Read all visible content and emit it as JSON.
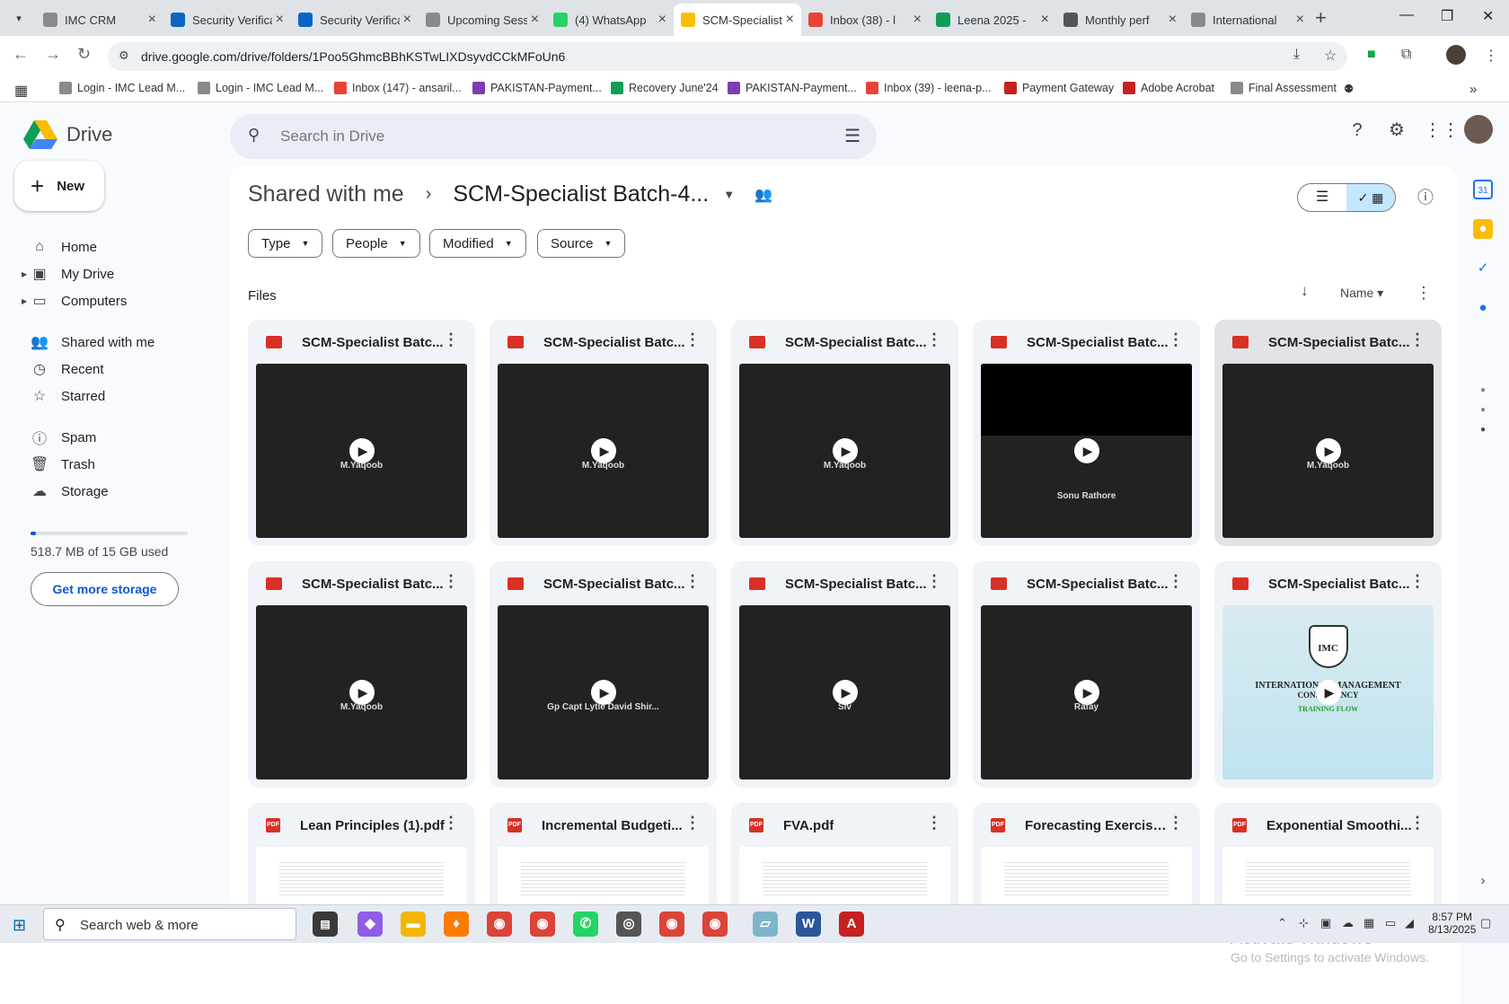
{
  "tabs": [
    {
      "label": "IMC CRM",
      "icon": "imc-icon",
      "color": "#8a8a8a"
    },
    {
      "label": "Security Verification",
      "icon": "linkedin-icon",
      "color": "#0a66c2"
    },
    {
      "label": "Security Verification",
      "icon": "linkedin-icon",
      "color": "#0a66c2"
    },
    {
      "label": "Upcoming Sessions",
      "icon": "imc-icon",
      "color": "#8a8a8a"
    },
    {
      "label": "(4) WhatsApp",
      "icon": "whatsapp-icon",
      "color": "#25d366"
    },
    {
      "label": "SCM-Specialist",
      "icon": "drive-icon",
      "color": "#fbbc04"
    },
    {
      "label": "Inbox (38) - l",
      "icon": "gmail-icon",
      "color": "#ea4335"
    },
    {
      "label": "Leena 2025 -",
      "icon": "sheets-icon",
      "color": "#0f9d58"
    },
    {
      "label": "Monthly perf",
      "icon": "openai-icon",
      "color": "#555555"
    },
    {
      "label": "International",
      "icon": "imc-icon",
      "color": "#8a8a8a"
    }
  ],
  "browser": {
    "url": "drive.google.com/drive/folders/1Poo5GhmcBBhKSTwLIXDsyvdCCkMFoUn6"
  },
  "bookmarks": [
    {
      "label": "Login - IMC Lead M...",
      "color": "#8a8a8a"
    },
    {
      "label": "Login - IMC Lead M...",
      "color": "#8a8a8a"
    },
    {
      "label": "Inbox (147) - ansaril...",
      "color": "#ea4335"
    },
    {
      "label": "PAKISTAN-Payment...",
      "color": "#7b3fb0"
    },
    {
      "label": "Recovery June'24",
      "color": "#0f9d58"
    },
    {
      "label": "PAKISTAN-Payment...",
      "color": "#7b3fb0"
    },
    {
      "label": "Inbox (39) - leena-p...",
      "color": "#ea4335"
    },
    {
      "label": "Payment Gateway",
      "color": "#c5221f"
    },
    {
      "label": "Adobe Acrobat",
      "color": "#c5221f"
    },
    {
      "label": "Final Assessment",
      "color": "#8a8a8a"
    }
  ],
  "drive": {
    "brand": "Drive",
    "search_placeholder": "Search in Drive",
    "new_label": "New",
    "nav": [
      {
        "label": "Home",
        "icon": "home-icon"
      },
      {
        "label": "My Drive",
        "icon": "my-drive-icon"
      },
      {
        "label": "Computers",
        "icon": "computers-icon"
      },
      {
        "label": "Shared with me",
        "icon": "shared-icon"
      },
      {
        "label": "Recent",
        "icon": "recent-icon"
      },
      {
        "label": "Starred",
        "icon": "star-icon"
      },
      {
        "label": "Spam",
        "icon": "spam-icon"
      },
      {
        "label": "Trash",
        "icon": "trash-icon"
      },
      {
        "label": "Storage",
        "icon": "cloud-icon"
      }
    ],
    "storage_text": "518.7 MB of 15 GB used",
    "storage_fraction": 0.035,
    "get_more": "Get more storage",
    "breadcrumb_parent": "Shared with me",
    "breadcrumb_current": "SCM-Specialist Batch-4...",
    "filters": [
      "Type",
      "People",
      "Modified",
      "Source"
    ],
    "files_label": "Files",
    "sort_label": "Name",
    "files": [
      {
        "name": "SCM-Specialist Batc...",
        "type": "video",
        "sub": "M.Yaqoob"
      },
      {
        "name": "SCM-Specialist Batc...",
        "type": "video",
        "sub": "M.Yaqoob"
      },
      {
        "name": "SCM-Specialist Batc...",
        "type": "video",
        "sub": "M.Yaqoob"
      },
      {
        "name": "SCM-Specialist Batc...",
        "type": "video",
        "sub": "Sonu Rathore"
      },
      {
        "name": "SCM-Specialist Batc...",
        "type": "video",
        "sub": "M.Yaqoob"
      },
      {
        "name": "SCM-Specialist Batc...",
        "type": "video",
        "sub": "M.Yaqoob"
      },
      {
        "name": "SCM-Specialist Batc...",
        "type": "video",
        "sub": "Gp Capt Lytle David Shir..."
      },
      {
        "name": "SCM-Specialist Batc...",
        "type": "video",
        "sub": "Siv"
      },
      {
        "name": "SCM-Specialist Batc...",
        "type": "video",
        "sub": "Rafay"
      },
      {
        "name": "SCM-Specialist Batc...",
        "type": "video",
        "sub": ""
      },
      {
        "name": "Lean Principles (1).pdf",
        "type": "pdf",
        "sub": ""
      },
      {
        "name": "Incremental Budgeti...",
        "type": "pdf",
        "sub": ""
      },
      {
        "name": "FVA.pdf",
        "type": "pdf",
        "sub": ""
      },
      {
        "name": "Forecasting Exercise...",
        "type": "pdf",
        "sub": ""
      },
      {
        "name": "Exponential Smoothi...",
        "type": "pdf",
        "sub": ""
      }
    ],
    "imc_logo": {
      "line1": "IMC",
      "line2": "INTERNATIONAL MANAGEMENT",
      "line3": "CONSULTANCY",
      "line4": "TRAINING FLOW"
    },
    "activate_title": "Activate Windows",
    "activate_sub": "Go to Settings to activate Windows."
  },
  "taskbar": {
    "search_label": "Search web & more",
    "time": "8:57 PM",
    "date": "8/13/2025"
  }
}
